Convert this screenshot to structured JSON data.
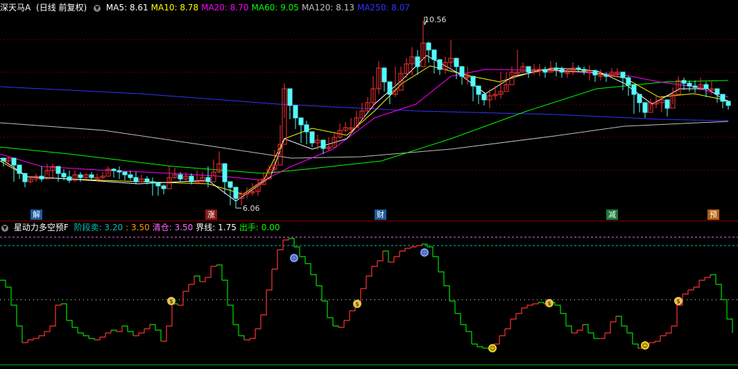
{
  "main_header": {
    "title": "深天马A",
    "period": "(日线 前复权)",
    "ma": [
      {
        "label": "MA5: ",
        "value": "8.61",
        "color": "#ffffff"
      },
      {
        "label": "MA10: ",
        "value": "8.78",
        "color": "#ffff00"
      },
      {
        "label": "MA20: ",
        "value": "8.70",
        "color": "#ff00ff"
      },
      {
        "label": "MA60: ",
        "value": "9.05",
        "color": "#00ff00"
      },
      {
        "label": "MA120: ",
        "value": "8.13",
        "color": "#c0c0c0"
      },
      {
        "label": "MA250: ",
        "value": "8.07",
        "color": "#3333ff"
      }
    ]
  },
  "price_labels": {
    "high": "10.56",
    "low": "6.06"
  },
  "event_tags": [
    {
      "text": "解",
      "color": "#1e5b9a"
    },
    {
      "text": "涨",
      "color": "#8b1a1a"
    },
    {
      "text": "财",
      "color": "#1e5b9a"
    },
    {
      "text": "减",
      "color": "#1e7a3a"
    },
    {
      "text": "预",
      "color": "#b06010"
    }
  ],
  "indicator_header": {
    "name": "星动力多空预F",
    "items": [
      {
        "label": "阶段卖: ",
        "value": "3.20",
        "color": "#00c0c0"
      },
      {
        "label": ": ",
        "value": "3.50",
        "color": "#ff9900"
      },
      {
        "label": "清仓: ",
        "value": "3.50",
        "color": "#ff66ff"
      },
      {
        "label": "界线: ",
        "value": "1.75",
        "color": "#ffffff"
      },
      {
        "label": "出手: ",
        "value": "0.00",
        "color": "#00ff00"
      }
    ]
  },
  "colors": {
    "up": "#ff3333",
    "down": "#54fcfc",
    "ind_up": "#ff3333",
    "ind_down": "#00e000"
  }
}
